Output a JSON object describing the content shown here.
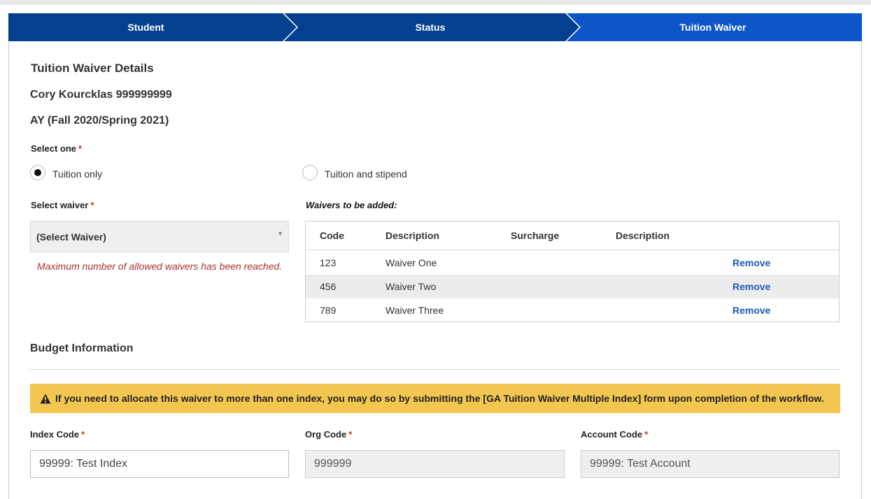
{
  "steps": [
    {
      "label": "Student"
    },
    {
      "label": "Status"
    },
    {
      "label": "Tuition Waiver"
    }
  ],
  "colors": {
    "step_inactive": "#03418f",
    "step_active": "#0d56c8",
    "required": "#c0392b",
    "link": "#1c5bb0",
    "warning_bg": "#f3c651"
  },
  "page": {
    "title": "Tuition Waiver Details",
    "student_line": "Cory Kourcklas 999999999",
    "ay_line": "AY (Fall 2020/Spring 2021)"
  },
  "select_one": {
    "label": "Select one",
    "required_mark": "*",
    "options": [
      {
        "label": "Tuition only",
        "checked": true
      },
      {
        "label": "Tuition and stipend",
        "checked": false
      }
    ]
  },
  "select_waiver": {
    "label": "Select waiver",
    "required_mark": "*",
    "value": "(Select Waiver)",
    "error": "Maximum number of allowed waivers has been reached."
  },
  "waivers_table": {
    "title": "Waivers to be added:",
    "columns": [
      "Code",
      "Description",
      "Surcharge",
      "Description"
    ],
    "rows": [
      {
        "code": "123",
        "description": "Waiver One",
        "surcharge": "",
        "description2": "",
        "action": "Remove"
      },
      {
        "code": "456",
        "description": "Waiver Two",
        "surcharge": "",
        "description2": "",
        "action": "Remove"
      },
      {
        "code": "789",
        "description": "Waiver Three",
        "surcharge": "",
        "description2": "",
        "action": "Remove"
      }
    ]
  },
  "budget": {
    "title": "Budget Information",
    "warning": "If you need to allocate this waiver to more than one index, you may do so by submitting the [GA Tuition Waiver Multiple Index] form upon completion of the workflow.",
    "fields": [
      {
        "label": "Index Code",
        "required_mark": "*",
        "value": "99999: Test Index"
      },
      {
        "label": "Org Code",
        "required_mark": "*",
        "value": "999999"
      },
      {
        "label": "Account Code",
        "required_mark": "*",
        "value": "99999: Test Account"
      }
    ]
  }
}
